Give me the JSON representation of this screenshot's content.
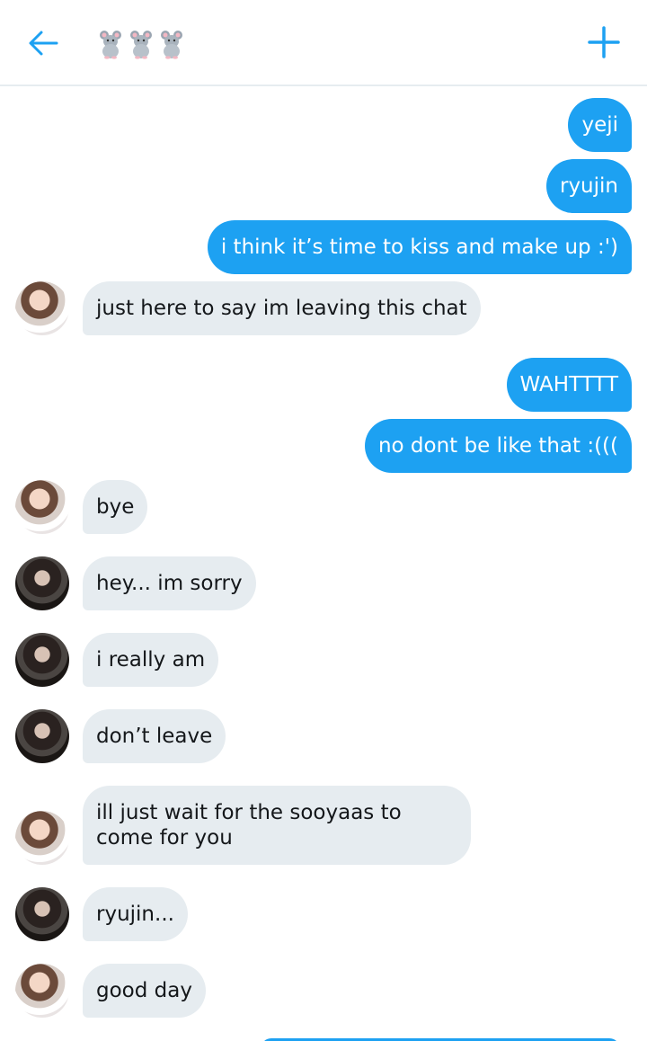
{
  "header": {
    "title": "",
    "title_icons": [
      "mouse-icon",
      "mouse-icon",
      "mouse-icon"
    ],
    "back_icon": "arrow-left-icon",
    "add_icon": "plus-icon",
    "accent": "#1da1f2"
  },
  "messages": [
    {
      "side": "out",
      "text": "yeji"
    },
    {
      "side": "out",
      "text": "ryujin"
    },
    {
      "side": "out",
      "text": "i think it’s time to kiss and make up :')"
    },
    {
      "side": "in",
      "avatar": "avatar-a",
      "text": "just here to say im leaving this chat"
    },
    {
      "side": "out",
      "text": "WAHTTTT"
    },
    {
      "side": "out",
      "text": "no dont be like that :((("
    },
    {
      "side": "in",
      "avatar": "avatar-a",
      "text": "bye"
    },
    {
      "side": "in",
      "avatar": "avatar-b",
      "text": "hey... im sorry"
    },
    {
      "side": "in",
      "avatar": "avatar-b",
      "text": "i really am"
    },
    {
      "side": "in",
      "avatar": "avatar-b",
      "text": "don’t leave"
    },
    {
      "side": "in",
      "avatar": "avatar-a",
      "text": "ill just wait for the sooyaas to come for you"
    },
    {
      "side": "in",
      "avatar": "avatar-b",
      "text": "ryujin..."
    },
    {
      "side": "in",
      "avatar": "avatar-a",
      "text": "good day"
    }
  ],
  "colors": {
    "outgoing_bubble": "#1da1f2",
    "incoming_bubble": "#e6ecf0",
    "divider": "#e6ecf0"
  }
}
